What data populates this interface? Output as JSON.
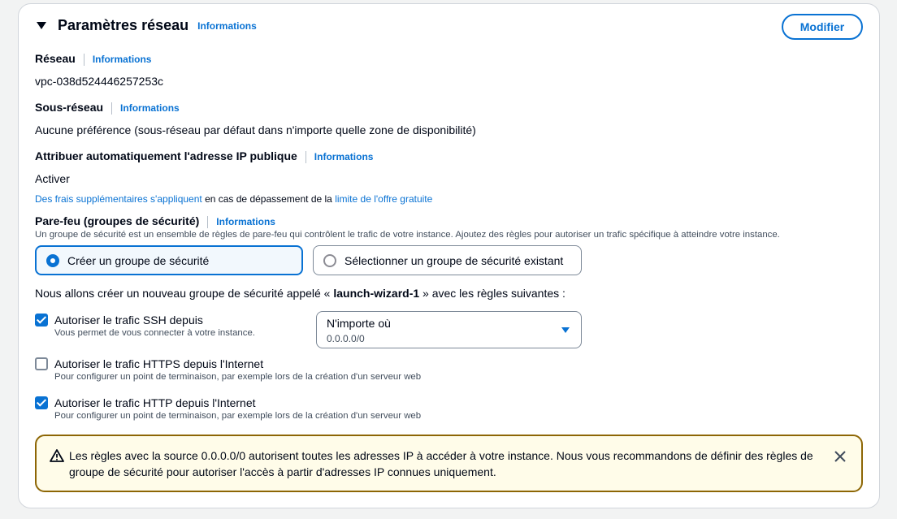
{
  "panel": {
    "title": "Paramètres réseau",
    "info": "Informations",
    "modify_label": "Modifier"
  },
  "network": {
    "label": "Réseau",
    "info": "Informations",
    "value": "vpc-038d524446257253c"
  },
  "subnet": {
    "label": "Sous-réseau",
    "info": "Informations",
    "value": "Aucune préférence (sous-réseau par défaut dans n'importe quelle zone de disponibilité)"
  },
  "public_ip": {
    "label": "Attribuer automatiquement l'adresse IP publique",
    "info": "Informations",
    "value": "Activer",
    "charges_link": "Des frais supplémentaires s'appliquent",
    "charges_text": " en cas de dépassement de la ",
    "free_tier_link": "limite de l'offre gratuite"
  },
  "firewall": {
    "label": "Pare-feu (groupes de sécurité)",
    "info": "Informations",
    "description": "Un groupe de sécurité est un ensemble de règles de pare-feu qui contrôlent le trafic de votre instance. Ajoutez des règles pour autoriser un trafic spécifique à atteindre votre instance.",
    "option_create": "Créer un groupe de sécurité",
    "option_existing": "Sélectionner un groupe de sécurité existant",
    "create_prefix": "Nous allons créer un nouveau groupe de sécurité appelé « ",
    "group_name": "launch-wizard-1",
    "create_suffix": " » avec les règles suivantes :"
  },
  "rules": [
    {
      "label": "Autoriser le trafic SSH depuis",
      "description": "Vous permet de vous connecter à votre instance.",
      "checked": true
    },
    {
      "label": "Autoriser le trafic HTTPS depuis l'Internet",
      "description": "Pour configurer un point de terminaison, par exemple lors de la création d'un serveur web",
      "checked": false
    },
    {
      "label": "Autoriser le trafic HTTP depuis l'Internet",
      "description": "Pour configurer un point de terminaison, par exemple lors de la création d'un serveur web",
      "checked": true
    }
  ],
  "ssh_source": {
    "value": "N'importe où",
    "cidr": "0.0.0.0/0"
  },
  "warning": {
    "text": "Les règles avec la source 0.0.0.0/0 autorisent toutes les adresses IP à accéder à votre instance. Nous vous recommandons de définir des règles de groupe de sécurité pour autoriser l'accès à partir d'adresses IP connues uniquement."
  },
  "colors": {
    "accent": "#0972d3",
    "warning_border": "#8d6605",
    "warning_bg": "#fffce9"
  }
}
